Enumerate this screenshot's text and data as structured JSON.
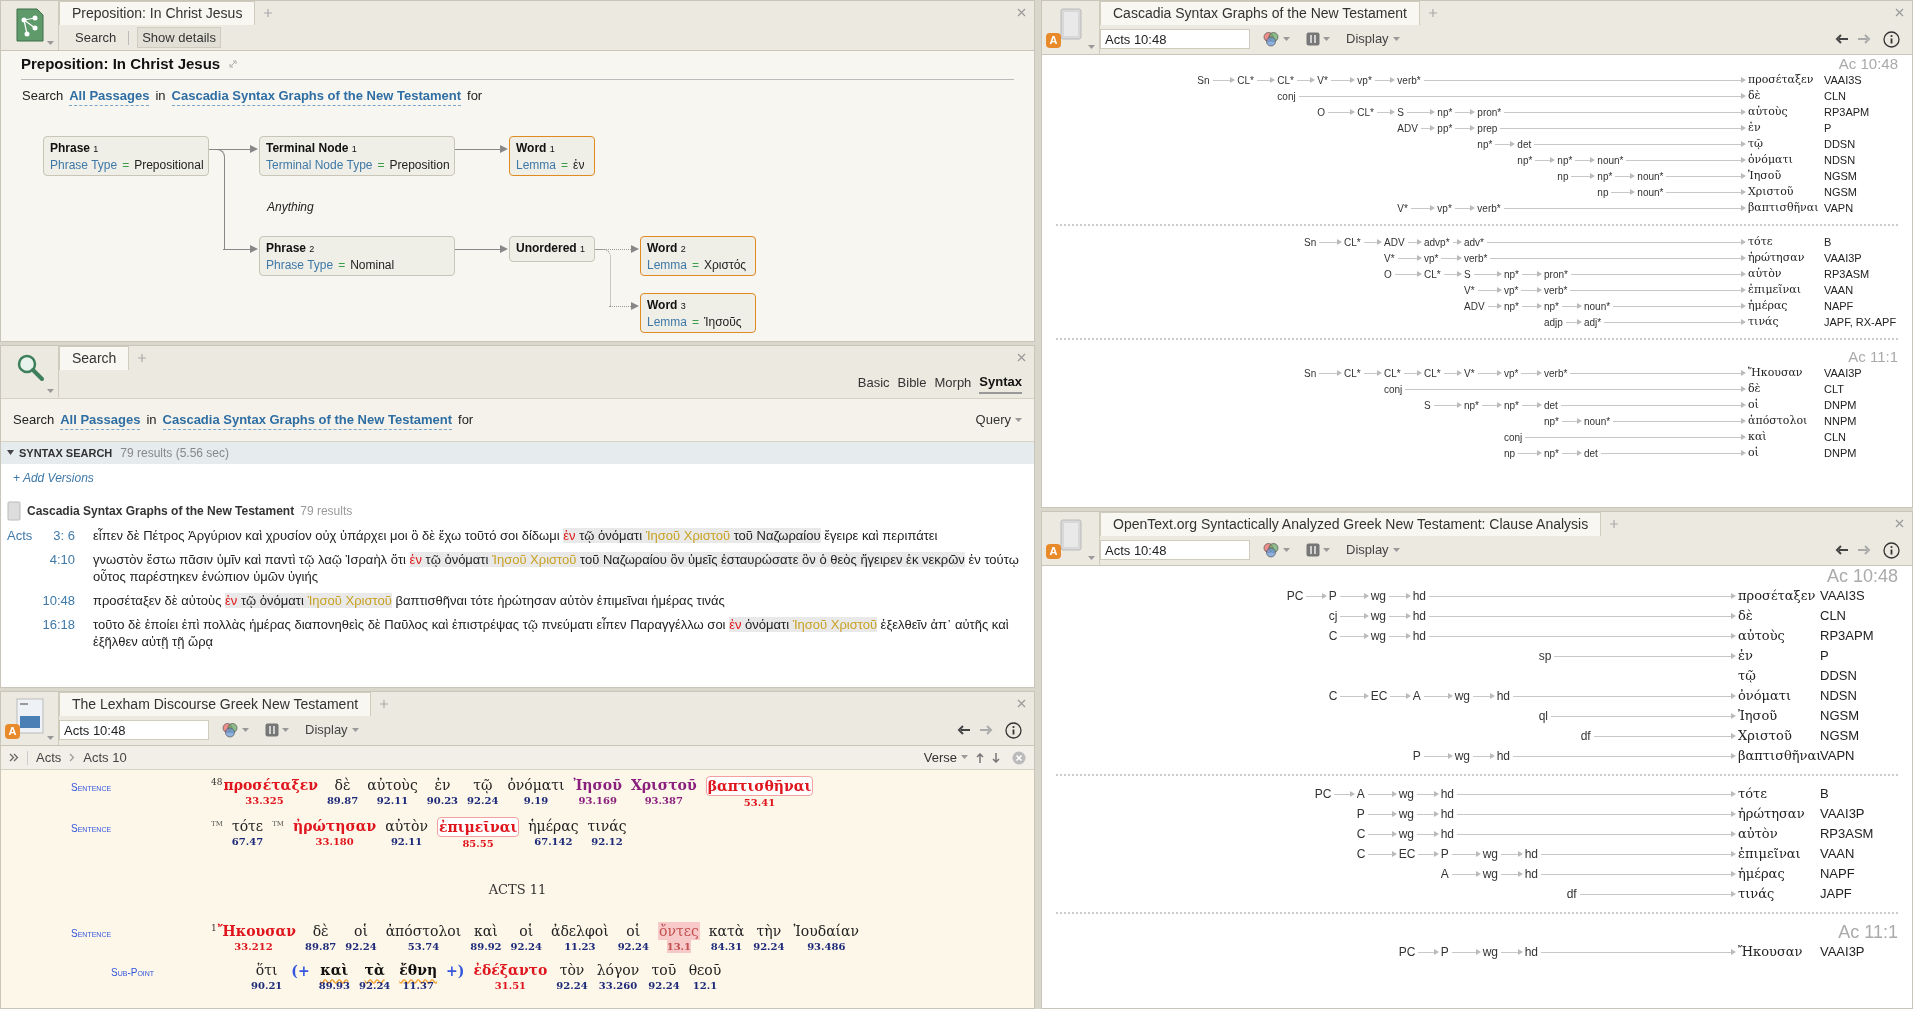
{
  "query_panel": {
    "tab": "Preposition: In Christ Jesus",
    "toolbar": [
      "Search",
      "Show details"
    ],
    "title": "Preposition: In Christ Jesus",
    "search_line": {
      "prefix": "Search",
      "range": "All Passages",
      "joiner": "in",
      "resource": "Cascadia Syntax Graphs of the New Testament",
      "suffix": "for"
    },
    "graph": {
      "title": "Phrase",
      "index": "1",
      "attr": "Phrase Type",
      "operator": "=",
      "value": "Prepositional",
      "highlighted": false,
      "children": [
        {
          "title": "Terminal Node",
          "index": "1",
          "attr": "Terminal Node Type",
          "operator": "=",
          "value": "Preposition",
          "highlighted": false,
          "dotted": false,
          "children": [
            {
              "title": "Word",
              "index": "1",
              "attr": "Lemma",
              "operator": "=",
              "value": "ἐν",
              "highlighted": true,
              "dotted": false
            }
          ]
        },
        {
          "title": "Phrase",
          "index": "2",
          "attr": "Phrase Type",
          "operator": "=",
          "value": "Nominal",
          "highlighted": false,
          "dotted": false,
          "children": [
            {
              "title": "Unordered",
              "index": "1",
              "highlighted": false,
              "dotted": false,
              "children": [
                {
                  "title": "Word",
                  "index": "2",
                  "attr": "Lemma",
                  "operator": "=",
                  "value": "Χριστός",
                  "highlighted": true,
                  "dotted": true
                },
                {
                  "title": "Word",
                  "index": "3",
                  "attr": "Lemma",
                  "operator": "=",
                  "value": "Ἰησοῦς",
                  "highlighted": true,
                  "dotted": true
                }
              ]
            }
          ]
        }
      ]
    },
    "note": "Anything"
  },
  "search_panel": {
    "tab": "Search",
    "modes": [
      {
        "label": "Basic",
        "selected": false
      },
      {
        "label": "Bible",
        "selected": false
      },
      {
        "label": "Morph",
        "selected": false
      },
      {
        "label": "Syntax",
        "selected": true
      }
    ],
    "search_line": {
      "prefix": "Search",
      "range": "All Passages",
      "joiner": "in",
      "resource": "Cascadia Syntax Graphs of the New Testament",
      "suffix": "for"
    },
    "query_button": "Query",
    "section": {
      "title": "SYNTAX SEARCH",
      "summary": "79 results (5.56 sec)",
      "expanded": true
    },
    "add_versions": "+ Add Versions",
    "resource": {
      "title": "Cascadia Syntax Graphs of the New Testament",
      "count": "79 results"
    },
    "results": [
      {
        "book": "Acts",
        "ref": "3: 6",
        "segments": [
          {
            "kind": "text",
            "text": "εἶπεν δὲ Πέτρος Ἀργύριον καὶ χρυσίον οὐχ ὑπάρχει μοι ὃ δὲ ἔχω τοῦτό σοι δίδωμι "
          },
          {
            "kind": "lemma",
            "text": "ἐν"
          },
          {
            "kind": "match",
            "text": " τῷ ὀνόματι "
          },
          {
            "kind": "name",
            "text": "Ἰησοῦ Χριστοῦ"
          },
          {
            "kind": "match",
            "text": " τοῦ Ναζωραίου"
          },
          {
            "kind": "text",
            "text": " ἔγειρε καὶ περιπάτει"
          }
        ]
      },
      {
        "ref": "4:10",
        "segments": [
          {
            "kind": "text",
            "text": "γνωστὸν ἔστω πᾶσιν ὑμῖν καὶ παντὶ τῷ λαῷ Ἰσραὴλ ὅτι "
          },
          {
            "kind": "lemma",
            "text": "ἐν"
          },
          {
            "kind": "match",
            "text": " τῷ ὀνόματι "
          },
          {
            "kind": "name",
            "text": "Ἰησοῦ Χριστοῦ"
          },
          {
            "kind": "match",
            "text": " τοῦ Ναζωραίου ὃν ὑμεῖς ἐσταυρώσατε ὃν ὁ θεὸς ἤγειρεν ἐκ νεκρῶν"
          },
          {
            "kind": "text",
            "text": " ἐν τούτῳ οὗτος παρέστηκεν ἐνώπιον ὑμῶν ὑγιής"
          }
        ]
      },
      {
        "ref": "10:48",
        "segments": [
          {
            "kind": "text",
            "text": "προσέταξεν δὲ αὐτοὺς "
          },
          {
            "kind": "lemma",
            "text": "ἐν"
          },
          {
            "kind": "match",
            "text": " τῷ ὀνόματι "
          },
          {
            "kind": "name",
            "text": "Ἰησοῦ Χριστοῦ"
          },
          {
            "kind": "text",
            "text": " βαπτισθῆναι τότε ἠρώτησαν αὐτὸν ἐπιμεῖναι ἡμέρας τινάς"
          }
        ]
      },
      {
        "ref": "16:18",
        "segments": [
          {
            "kind": "text",
            "text": "τοῦτο δὲ ἐποίει ἐπὶ πολλὰς ἡμέρας διαπονηθεὶς δὲ Παῦλος καὶ ἐπιστρέψας τῷ πνεύματι εἶπεν Παραγγέλλω σοι "
          },
          {
            "kind": "lemma",
            "text": "ἐν"
          },
          {
            "kind": "match",
            "text": " ὀνόματι "
          },
          {
            "kind": "name",
            "text": "Ἰησοῦ Χριστοῦ"
          },
          {
            "kind": "text",
            "text": " ἐξελθεῖν ἀπ᾽ αὐτῆς καὶ ἐξῆλθεν αὐτῇ τῇ ὥρᾳ"
          }
        ]
      }
    ]
  },
  "discourse_panel": {
    "tab": "The Lexham Discourse Greek New Testament",
    "badge": "A",
    "reference": "Acts 10:48",
    "display": "Display",
    "breadcrumb": [
      "Acts",
      "Acts 10"
    ],
    "unit": "Verse",
    "blocks": [
      {
        "kind": "line",
        "label": "Sentence",
        "items": [
          {
            "kind": "emph",
            "verse": "48",
            "text": "προσέταξεν",
            "lex": "33.325"
          },
          {
            "kind": "plain",
            "text": "δὲ",
            "lex": "89.87"
          },
          {
            "kind": "plain",
            "text": "αὐτοὺς",
            "lex": "92.11"
          },
          {
            "kind": "plain",
            "text": "ἐν",
            "lex": "90.23"
          },
          {
            "kind": "plain",
            "text": "τῷ",
            "lex": "92.24"
          },
          {
            "kind": "plain",
            "text": "ὀνόματι",
            "lex": "9.19"
          },
          {
            "kind": "name",
            "text": "Ἰησοῦ",
            "lex": "93.169"
          },
          {
            "kind": "name",
            "text": "Χριστοῦ",
            "lex": "93.387"
          },
          {
            "kind": "outlined",
            "text": "βαπτισθῆναι",
            "lex": "53.41"
          }
        ]
      },
      {
        "kind": "line",
        "label": "Sentence",
        "items": [
          {
            "kind": "marker",
            "text": "TM"
          },
          {
            "kind": "plain",
            "text": "τότε",
            "lex": "67.47"
          },
          {
            "kind": "marker",
            "text": "TM"
          },
          {
            "kind": "emph",
            "text": "ἠρώτησαν",
            "lex": "33.180"
          },
          {
            "kind": "plain",
            "text": "αὐτὸν",
            "lex": "92.11"
          },
          {
            "kind": "outlined",
            "text": "ἐπιμεῖναι",
            "lex": "85.55"
          },
          {
            "kind": "plain",
            "text": "ἡμέρας",
            "lex": "67.142"
          },
          {
            "kind": "plain",
            "text": "τινάς",
            "lex": "92.12"
          }
        ]
      },
      {
        "kind": "heading",
        "text": "ACTS 11"
      },
      {
        "kind": "line",
        "label": "Sentence",
        "items": [
          {
            "kind": "emph",
            "verse": "1",
            "text": "Ἤκουσαν",
            "lex": "33.212"
          },
          {
            "kind": "plain",
            "text": "δὲ",
            "lex": "89.87"
          },
          {
            "kind": "plain",
            "text": "οἱ",
            "lex": "92.24"
          },
          {
            "kind": "plain",
            "text": "ἀπόστολοι",
            "lex": "53.74"
          },
          {
            "kind": "plain",
            "text": "καὶ",
            "lex": "89.92"
          },
          {
            "kind": "plain",
            "text": "οἱ",
            "lex": "92.24"
          },
          {
            "kind": "plain",
            "text": "ἀδελφοὶ",
            "lex": "11.23"
          },
          {
            "kind": "plain",
            "text": "οἱ",
            "lex": "92.24"
          },
          {
            "kind": "highlighted",
            "text": "ὄντες",
            "lex": "13.1"
          },
          {
            "kind": "plain",
            "text": "κατὰ",
            "lex": "84.31"
          },
          {
            "kind": "plain",
            "text": "τὴν",
            "lex": "92.24"
          },
          {
            "kind": "plain",
            "text": "Ἰουδαίαν",
            "lex": "93.486"
          }
        ]
      },
      {
        "kind": "line",
        "label": "Sub-Point",
        "items": [
          {
            "kind": "plain",
            "text": "ὅτι",
            "lex": "90.21"
          },
          {
            "kind": "marker",
            "text": "(+"
          },
          {
            "kind": "topic",
            "text": "καὶ",
            "lex": "89.93"
          },
          {
            "kind": "topic",
            "text": "τὰ",
            "lex": "92.24"
          },
          {
            "kind": "topic",
            "text": "ἔθνη",
            "lex": "11.37"
          },
          {
            "kind": "marker",
            "text": "+)"
          },
          {
            "kind": "emph",
            "text": "ἐδέξαντο",
            "lex": "31.51"
          },
          {
            "kind": "plain",
            "text": "τὸν",
            "lex": "92.24"
          },
          {
            "kind": "plain",
            "text": "λόγον",
            "lex": "33.260"
          },
          {
            "kind": "plain",
            "text": "τοῦ",
            "lex": "92.24"
          },
          {
            "kind": "plain",
            "text": "θεοῦ",
            "lex": "12.1"
          }
        ]
      }
    ]
  },
  "graph_panels": [
    {
      "tab": "Cascadia Syntax Graphs of the New Testament",
      "badge": "A",
      "reference": "Acts 10:48",
      "display": "Display",
      "kind": "compact",
      "graphs": [
        {
          "label": "Ac 10:48",
          "tree": {
            "label": "Sn",
            "children": [
              {
                "label": "CL*",
                "children": [
                  {
                    "label": "CL*",
                    "children": [
                      {
                        "label": "V*",
                        "children": [
                          {
                            "label": "vp*",
                            "children": [
                              {
                                "label": "verb*",
                                "word": "προσέταξεν",
                                "tag": "VAAI3S"
                              }
                            ]
                          }
                        ]
                      }
                    ]
                  },
                  {
                    "label": "conj",
                    "word": "δὲ",
                    "tag": "CLN",
                    "children": [
                      {
                        "label": "O",
                        "children": [
                          {
                            "label": "CL*",
                            "children": [
                              {
                                "label": "S",
                                "children": [
                                  {
                                    "label": "np*",
                                    "children": [
                                      {
                                        "label": "pron*",
                                        "word": "αὐτοὺς",
                                        "tag": "RP3APM"
                                      }
                                    ]
                                  }
                                ]
                              },
                              {
                                "label": "ADV",
                                "children": [
                                  {
                                    "label": "pp*",
                                    "children": [
                                      {
                                        "label": "prep",
                                        "word": "ἐν",
                                        "tag": "P"
                                      },
                                      {
                                        "label": "np*",
                                        "children": [
                                          {
                                            "label": "det",
                                            "word": "τῷ",
                                            "tag": "DDSN"
                                          },
                                          {
                                            "label": "np*",
                                            "children": [
                                              {
                                                "label": "np*",
                                                "children": [
                                                  {
                                                    "label": "noun*",
                                                    "word": "ὀνόματι",
                                                    "tag": "NDSN"
                                                  }
                                                ]
                                              },
                                              {
                                                "label": "np",
                                                "children": [
                                                  {
                                                    "label": "np*",
                                                    "children": [
                                                      {
                                                        "label": "noun*",
                                                        "word": "Ἰησοῦ",
                                                        "tag": "NGSM"
                                                      }
                                                    ]
                                                  },
                                                  {
                                                    "label": "np",
                                                    "children": [
                                                      {
                                                        "label": "noun*",
                                                        "word": "Χριστοῦ",
                                                        "tag": "NGSM"
                                                      }
                                                    ]
                                                  }
                                                ]
                                              }
                                            ]
                                          }
                                        ]
                                      }
                                    ]
                                  }
                                ]
                              },
                              {
                                "label": "V*",
                                "children": [
                                  {
                                    "label": "vp*",
                                    "children": [
                                      {
                                        "label": "verb*",
                                        "word": "βαπτισθῆναι",
                                        "tag": "VAPN"
                                      }
                                    ]
                                  }
                                ]
                              }
                            ]
                          }
                        ]
                      }
                    ]
                  }
                ]
              }
            ]
          }
        },
        {
          "tree": {
            "label": "Sn",
            "children": [
              {
                "label": "CL*",
                "children": [
                  {
                    "label": "ADV",
                    "children": [
                      {
                        "label": "advp*",
                        "children": [
                          {
                            "label": "adv*",
                            "word": "τότε",
                            "tag": "B"
                          }
                        ]
                      }
                    ]
                  },
                  {
                    "label": "V*",
                    "children": [
                      {
                        "label": "vp*",
                        "children": [
                          {
                            "label": "verb*",
                            "word": "ἠρώτησαν",
                            "tag": "VAAI3P"
                          }
                        ]
                      }
                    ]
                  },
                  {
                    "label": "O",
                    "children": [
                      {
                        "label": "CL*",
                        "children": [
                          {
                            "label": "S",
                            "children": [
                              {
                                "label": "np*",
                                "children": [
                                  {
                                    "label": "pron*",
                                    "word": "αὐτὸν",
                                    "tag": "RP3ASM"
                                  }
                                ]
                              }
                            ]
                          },
                          {
                            "label": "V*",
                            "children": [
                              {
                                "label": "vp*",
                                "children": [
                                  {
                                    "label": "verb*",
                                    "word": "ἐπιμεῖναι",
                                    "tag": "VAAN"
                                  }
                                ]
                              }
                            ]
                          },
                          {
                            "label": "ADV",
                            "children": [
                              {
                                "label": "np*",
                                "children": [
                                  {
                                    "label": "np*",
                                    "children": [
                                      {
                                        "label": "noun*",
                                        "word": "ἡμέρας",
                                        "tag": "NAPF"
                                      }
                                    ]
                                  },
                                  {
                                    "label": "adjp",
                                    "children": [
                                      {
                                        "label": "adj*",
                                        "word": "τινάς",
                                        "tag": "JAPF, RX-APF"
                                      }
                                    ]
                                  }
                                ]
                              }
                            ]
                          }
                        ]
                      }
                    ]
                  }
                ]
              }
            ]
          }
        },
        {
          "label": "Ac 11:1",
          "tree": {
            "label": "Sn",
            "children": [
              {
                "label": "CL*",
                "children": [
                  {
                    "label": "CL*",
                    "children": [
                      {
                        "label": "CL*",
                        "children": [
                          {
                            "label": "V*",
                            "children": [
                              {
                                "label": "vp*",
                                "children": [
                                  {
                                    "label": "verb*",
                                    "word": "Ἤκουσαν",
                                    "tag": "VAAI3P"
                                  }
                                ]
                              }
                            ]
                          }
                        ]
                      }
                    ]
                  },
                  {
                    "label": "conj",
                    "word": "δὲ",
                    "tag": "CLT",
                    "children": [
                      {
                        "label": "S",
                        "children": [
                          {
                            "label": "np*",
                            "children": [
                              {
                                "label": "np*",
                                "children": [
                                  {
                                    "label": "det",
                                    "word": "οἱ",
                                    "tag": "DNPM"
                                  },
                                  {
                                    "label": "np*",
                                    "children": [
                                      {
                                        "label": "noun*",
                                        "word": "ἀπόστολοι",
                                        "tag": "NNPM"
                                      }
                                    ]
                                  }
                                ]
                              },
                              {
                                "label": "conj",
                                "word": "καὶ",
                                "tag": "CLN"
                              },
                              {
                                "label": "np",
                                "children": [
                                  {
                                    "label": "np*",
                                    "children": [
                                      {
                                        "label": "det",
                                        "word": "οἱ",
                                        "tag": "DNPM"
                                      }
                                    ]
                                  }
                                ]
                              }
                            ]
                          }
                        ]
                      }
                    ]
                  }
                ]
              }
            ]
          }
        }
      ]
    },
    {
      "tab": "OpenText.org Syntactically Analyzed Greek New Testament: Clause Analysis",
      "badge": "A",
      "reference": "Acts 10:48",
      "display": "Display",
      "kind": "large",
      "graphs": [
        {
          "label": "Ac 10:48",
          "tree": {
            "label": "PC",
            "children": [
              {
                "label": "P",
                "children": [
                  {
                    "label": "wg",
                    "children": [
                      {
                        "label": "hd",
                        "word": "προσέταξεν",
                        "tag": "VAAI3S"
                      }
                    ]
                  }
                ]
              },
              {
                "label": "cj",
                "children": [
                  {
                    "label": "wg",
                    "children": [
                      {
                        "label": "hd",
                        "word": "δὲ",
                        "tag": "CLN"
                      }
                    ]
                  }
                ]
              },
              {
                "label": "C",
                "children": [
                  {
                    "label": "wg",
                    "children": [
                      {
                        "label": "hd",
                        "word": "αὐτοὺς",
                        "tag": "RP3APM"
                      }
                    ]
                  }
                ]
              },
              {
                "label": "C",
                "children": [
                  {
                    "label": "EC",
                    "children": [
                      {
                        "label": "A",
                        "children": [
                          {
                            "label": "wg",
                            "children": [
                              {
                                "label": "hd",
                                "word": "ὀνόματι",
                                "tag": "NDSN",
                                "children_above": [
                                  {
                                    "label": "sp",
                                    "word": "ἐν",
                                    "tag": "P",
                                    "children": [
                                      {
                                        "word": "τῷ",
                                        "tag": "DDSN"
                                      }
                                    ]
                                  }
                                ],
                                "children": [
                                  {
                                    "label": "ql",
                                    "word": "Ἰησοῦ",
                                    "tag": "NGSM",
                                    "children": [
                                      {
                                        "label": "df",
                                        "word": "Χριστοῦ",
                                        "tag": "NGSM"
                                      }
                                    ]
                                  }
                                ]
                              }
                            ]
                          }
                        ]
                      },
                      {
                        "label": "P",
                        "children": [
                          {
                            "label": "wg",
                            "children": [
                              {
                                "label": "hd",
                                "word": "βαπτισθῆναι",
                                "tag": "VAPN"
                              }
                            ]
                          }
                        ]
                      }
                    ]
                  }
                ]
              }
            ]
          }
        },
        {
          "tree": {
            "label": "PC",
            "children": [
              {
                "label": "A",
                "children": [
                  {
                    "label": "wg",
                    "children": [
                      {
                        "label": "hd",
                        "word": "τότε",
                        "tag": "B"
                      }
                    ]
                  }
                ]
              },
              {
                "label": "P",
                "children": [
                  {
                    "label": "wg",
                    "children": [
                      {
                        "label": "hd",
                        "word": "ἠρώτησαν",
                        "tag": "VAAI3P"
                      }
                    ]
                  }
                ]
              },
              {
                "label": "C",
                "children": [
                  {
                    "label": "wg",
                    "children": [
                      {
                        "label": "hd",
                        "word": "αὐτὸν",
                        "tag": "RP3ASM"
                      }
                    ]
                  }
                ]
              },
              {
                "label": "C",
                "children": [
                  {
                    "label": "EC",
                    "children": [
                      {
                        "label": "P",
                        "children": [
                          {
                            "label": "wg",
                            "children": [
                              {
                                "label": "hd",
                                "word": "ἐπιμεῖναι",
                                "tag": "VAAN"
                              }
                            ]
                          }
                        ]
                      },
                      {
                        "label": "A",
                        "children": [
                          {
                            "label": "wg",
                            "children": [
                              {
                                "label": "hd",
                                "word": "ἡμέρας",
                                "tag": "NAPF",
                                "children": [
                                  {
                                    "label": "df",
                                    "word": "τινάς",
                                    "tag": "JAPF"
                                  }
                                ]
                              }
                            ]
                          }
                        ]
                      }
                    ]
                  }
                ]
              }
            ]
          }
        },
        {
          "label": "Ac 11:1",
          "tree": {
            "label": "PC",
            "children": [
              {
                "label": "P",
                "children": [
                  {
                    "label": "wg",
                    "children": [
                      {
                        "label": "hd",
                        "word": "Ἤκουσαν",
                        "tag": "VAAI3P"
                      }
                    ]
                  }
                ]
              }
            ]
          }
        }
      ]
    }
  ]
}
